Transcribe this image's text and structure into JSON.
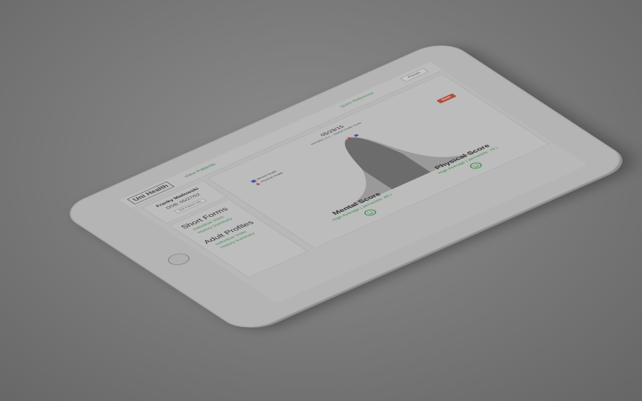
{
  "header": {
    "logo_text": "Uni Health",
    "view_patients": "View Patients",
    "quick_reference": "Quick Reference",
    "finish_label": "Finish"
  },
  "patient": {
    "name": "Franky Matlowski",
    "dob": "DOB: 05/27/52",
    "edit_button": "Edit Patient Info"
  },
  "nav": {
    "sections": [
      {
        "title": "Short Forms",
        "links": [
          "Individual Visits",
          "History Summary"
        ]
      },
      {
        "title": "Adult Profiles",
        "links": [
          "Individual Visits",
          "History Summary"
        ]
      }
    ]
  },
  "chart": {
    "date": "05/29/15",
    "subtitle": "PROMIS v1.1 – Global Health Scale",
    "save_label": "Save"
  },
  "chart_data": {
    "type": "area",
    "legend": [
      "Mental Health",
      "Physical Health"
    ],
    "legend_position": "top-left",
    "series_colors": {
      "Mental Health": "#3c5a9a",
      "Physical Health": "#b64a3e"
    }
  },
  "scores": {
    "mental": {
      "title": "Mental Score",
      "desc": "High Average ( percentile: 80 )"
    },
    "physical": {
      "title": "Physical Score",
      "desc": "High Average ( percentile: 78 )"
    }
  }
}
